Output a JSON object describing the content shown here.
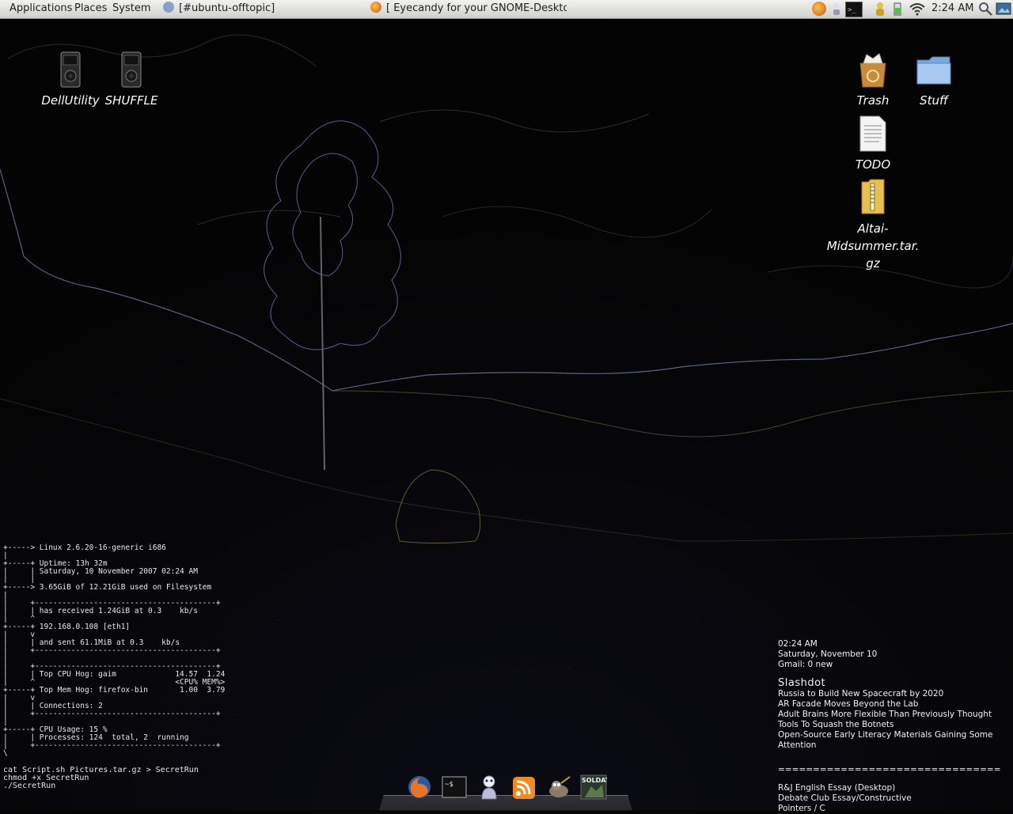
{
  "panel": {
    "menus": [
      "Applications",
      "Places",
      "System"
    ],
    "tasks": [
      {
        "label": "[#ubuntu-offtopic]",
        "icon": "chat-icon",
        "color": "#8aa0c8"
      },
      {
        "label": "[ Eyecandy for your GNOME-Deskto...",
        "icon": "firefox-icon",
        "color": "#e8742a"
      }
    ],
    "tray_icons": [
      "firefox-icon",
      "pidgin-icon",
      "terminal-icon",
      "user-icon",
      "battery-icon",
      "wifi-icon",
      "search-icon",
      "desktop-icon"
    ],
    "clock": "2:24 AM"
  },
  "desktop": {
    "icons": [
      {
        "label": "DellUtility",
        "kind": "ipod-icon"
      },
      {
        "label": "SHUFFLE",
        "kind": "ipod-icon"
      },
      {
        "label": "Trash",
        "kind": "trash-icon"
      },
      {
        "label": "Stuff",
        "kind": "folder-icon"
      },
      {
        "label": "TODO",
        "kind": "text-file-icon"
      },
      {
        "label": "Altai-Midsummer.tar.\ngz",
        "kind": "archive-icon"
      }
    ]
  },
  "conky": {
    "lines": [
      "+-----> Linux 2.6.20-16-generic i686",
      "|",
      "+-----+ Uptime: 13h 32m",
      "|     | Saturday, 10 November 2007 02:24 AM",
      "|     |",
      "+-----> 3.65GiB of 12.21GiB used on Filesystem",
      "|",
      "|     +----------------------------------------+",
      "|     | has received 1.24GiB at 0.3    kb/s",
      "|     ^",
      "+-----+ 192.168.0.108 [eth1]",
      "|     v",
      "|     | and sent 61.1MiB at 0.3    kb/s",
      "|     +----------------------------------------+",
      "|",
      "|     +----------------------------------------+",
      "|     | Top CPU Hog: gaim             14.57  1.24",
      "|     ^                               <CPU% MEM%>",
      "+-----+ Top Mem Hog: firefox-bin       1.00  3.79",
      "|     v",
      "|     | Connections: 2",
      "|     +----------------------------------------+",
      "|",
      "+-----+ CPU Usage: 15 %",
      "|     | Processes: 124  total, 2  running",
      "|     +----------------------------------------+",
      "\\"
    ]
  },
  "shell": {
    "lines": [
      "cat Script.sh Pictures.tar.gz > SecretRun",
      "chmod +x SecretRun",
      "./SecretRun"
    ]
  },
  "info": {
    "time": "02:24 AM",
    "date": "Saturday, November 10",
    "gmail": "Gmail: 0 new",
    "feed_title": "Slashdot",
    "headlines": [
      "Russia to Build New Spacecraft by 2020",
      "AR Facade Moves Beyond the Lab",
      "Adult Brains More Flexible Than Previously Thought",
      "Tools To Squash the Botnets",
      "Open-Source Early Literacy Materials Gaining Some Attention"
    ],
    "separator": "================================",
    "todo": [
      "R&J English Essay (Desktop)",
      "Debate Club Essay/Constructive",
      "Pointers / C"
    ]
  },
  "dock": {
    "items": [
      "firefox-icon",
      "terminal-icon",
      "pidgin-icon",
      "rss-icon",
      "gimp-icon",
      "soldat-icon"
    ],
    "soldat_label": "SOLDAT",
    "terminal_text": "~$"
  }
}
